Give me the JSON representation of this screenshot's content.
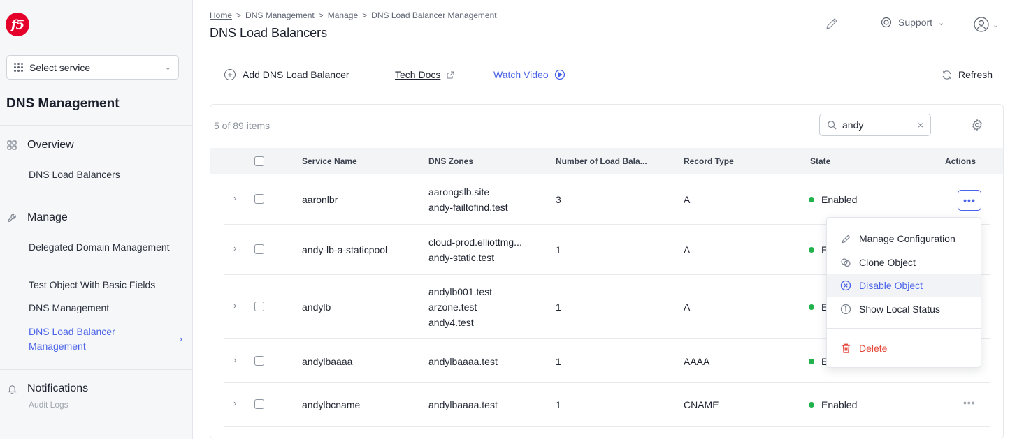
{
  "logo": {
    "text": "f5"
  },
  "sidebar": {
    "service_select": "Select service",
    "title": "DNS Management",
    "groups": [
      {
        "label": "Overview",
        "icon": "grid-icon",
        "items": [
          "DNS Load Balancers"
        ]
      },
      {
        "label": "Manage",
        "icon": "wrench-icon",
        "items": [
          "Delegated Domain Management",
          "Test Object With Basic Fields",
          "DNS Management",
          "DNS Load Balancer Management"
        ]
      },
      {
        "label": "Notifications",
        "icon": "bell-icon",
        "sub": "Audit Logs"
      }
    ]
  },
  "header": {
    "breadcrumb": [
      "Home",
      ">",
      "DNS Management",
      ">",
      "Manage",
      ">",
      "DNS Load Balancer Management"
    ],
    "title": "DNS Load Balancers",
    "support": "Support"
  },
  "toolbar": {
    "add": "Add DNS Load Balancer",
    "tech_docs": "Tech Docs",
    "watch_video": "Watch Video",
    "refresh": "Refresh"
  },
  "table": {
    "count": "5 of 89 items",
    "search_value": "andy",
    "columns": [
      "Service Name",
      "DNS Zones",
      "Number of Load Bala...",
      "Record Type",
      "State",
      "Actions"
    ],
    "rows": [
      {
        "name": "aaronlbr",
        "zones": [
          "aarongslb.site",
          "andy-failtofind.test"
        ],
        "count": "3",
        "type": "A",
        "state": "Enabled"
      },
      {
        "name": "andy-lb-a-staticpool",
        "zones": [
          "cloud-prod.elliottmg...",
          "andy-static.test"
        ],
        "count": "1",
        "type": "A",
        "state": "Enabled"
      },
      {
        "name": "andylb",
        "zones": [
          "andylb001.test",
          "arzone.test",
          "andy4.test"
        ],
        "count": "1",
        "type": "A",
        "state": "Enabled"
      },
      {
        "name": "andylbaaaa",
        "zones": [
          "andylbaaaa.test"
        ],
        "count": "1",
        "type": "AAAA",
        "state": "Enabled"
      },
      {
        "name": "andylbcname",
        "zones": [
          "andylbaaaa.test"
        ],
        "count": "1",
        "type": "CNAME",
        "state": "Enabled"
      }
    ]
  },
  "menu": {
    "items": [
      "Manage Configuration",
      "Clone Object",
      "Disable Object",
      "Show Local Status",
      "Delete"
    ]
  },
  "colors": {
    "accent": "#4a63e8",
    "enabled": "#21b24b",
    "danger": "#e5483a",
    "brand": "#e4002b"
  }
}
